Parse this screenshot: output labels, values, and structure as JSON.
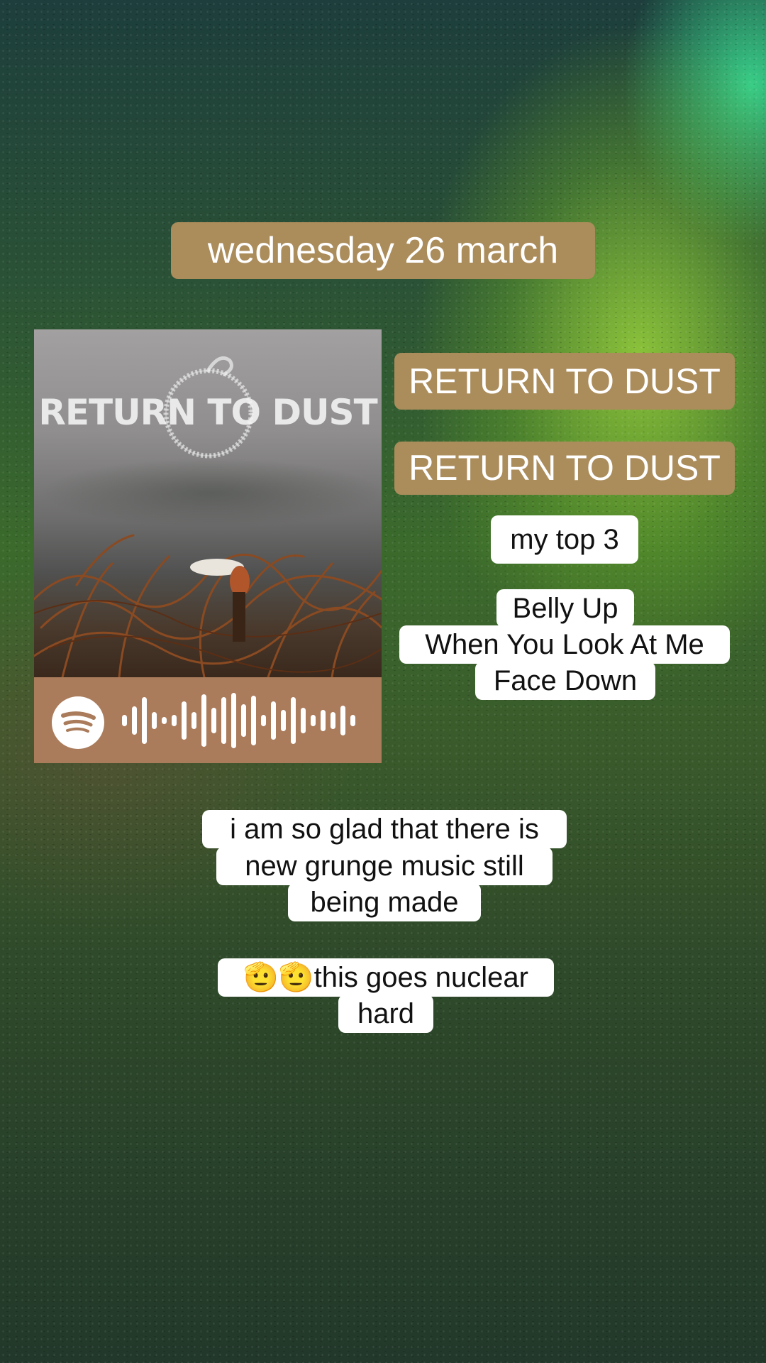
{
  "date": "wednesday 26 march",
  "album": {
    "title_1": "RETURN TO DUST",
    "title_2": "RETURN TO DUST",
    "cover_text": "RETURN TO DUST"
  },
  "top3": {
    "heading": "my top 3",
    "tracks": [
      "Belly Up",
      "When You Look At Me",
      "Face Down"
    ]
  },
  "comment": {
    "lines": [
      "i am so glad that there is",
      "new grunge music still",
      "being made"
    ]
  },
  "hype": {
    "lines": [
      "🫡🫡this goes nuclear",
      "hard"
    ]
  },
  "icons": {
    "spotify": "spotify-icon",
    "spotify_code": "spotify-code-icon"
  },
  "colors": {
    "gold_label": "#ab8c5b",
    "code_bar": "#aa7c5c",
    "white_label": "#ffffff"
  }
}
